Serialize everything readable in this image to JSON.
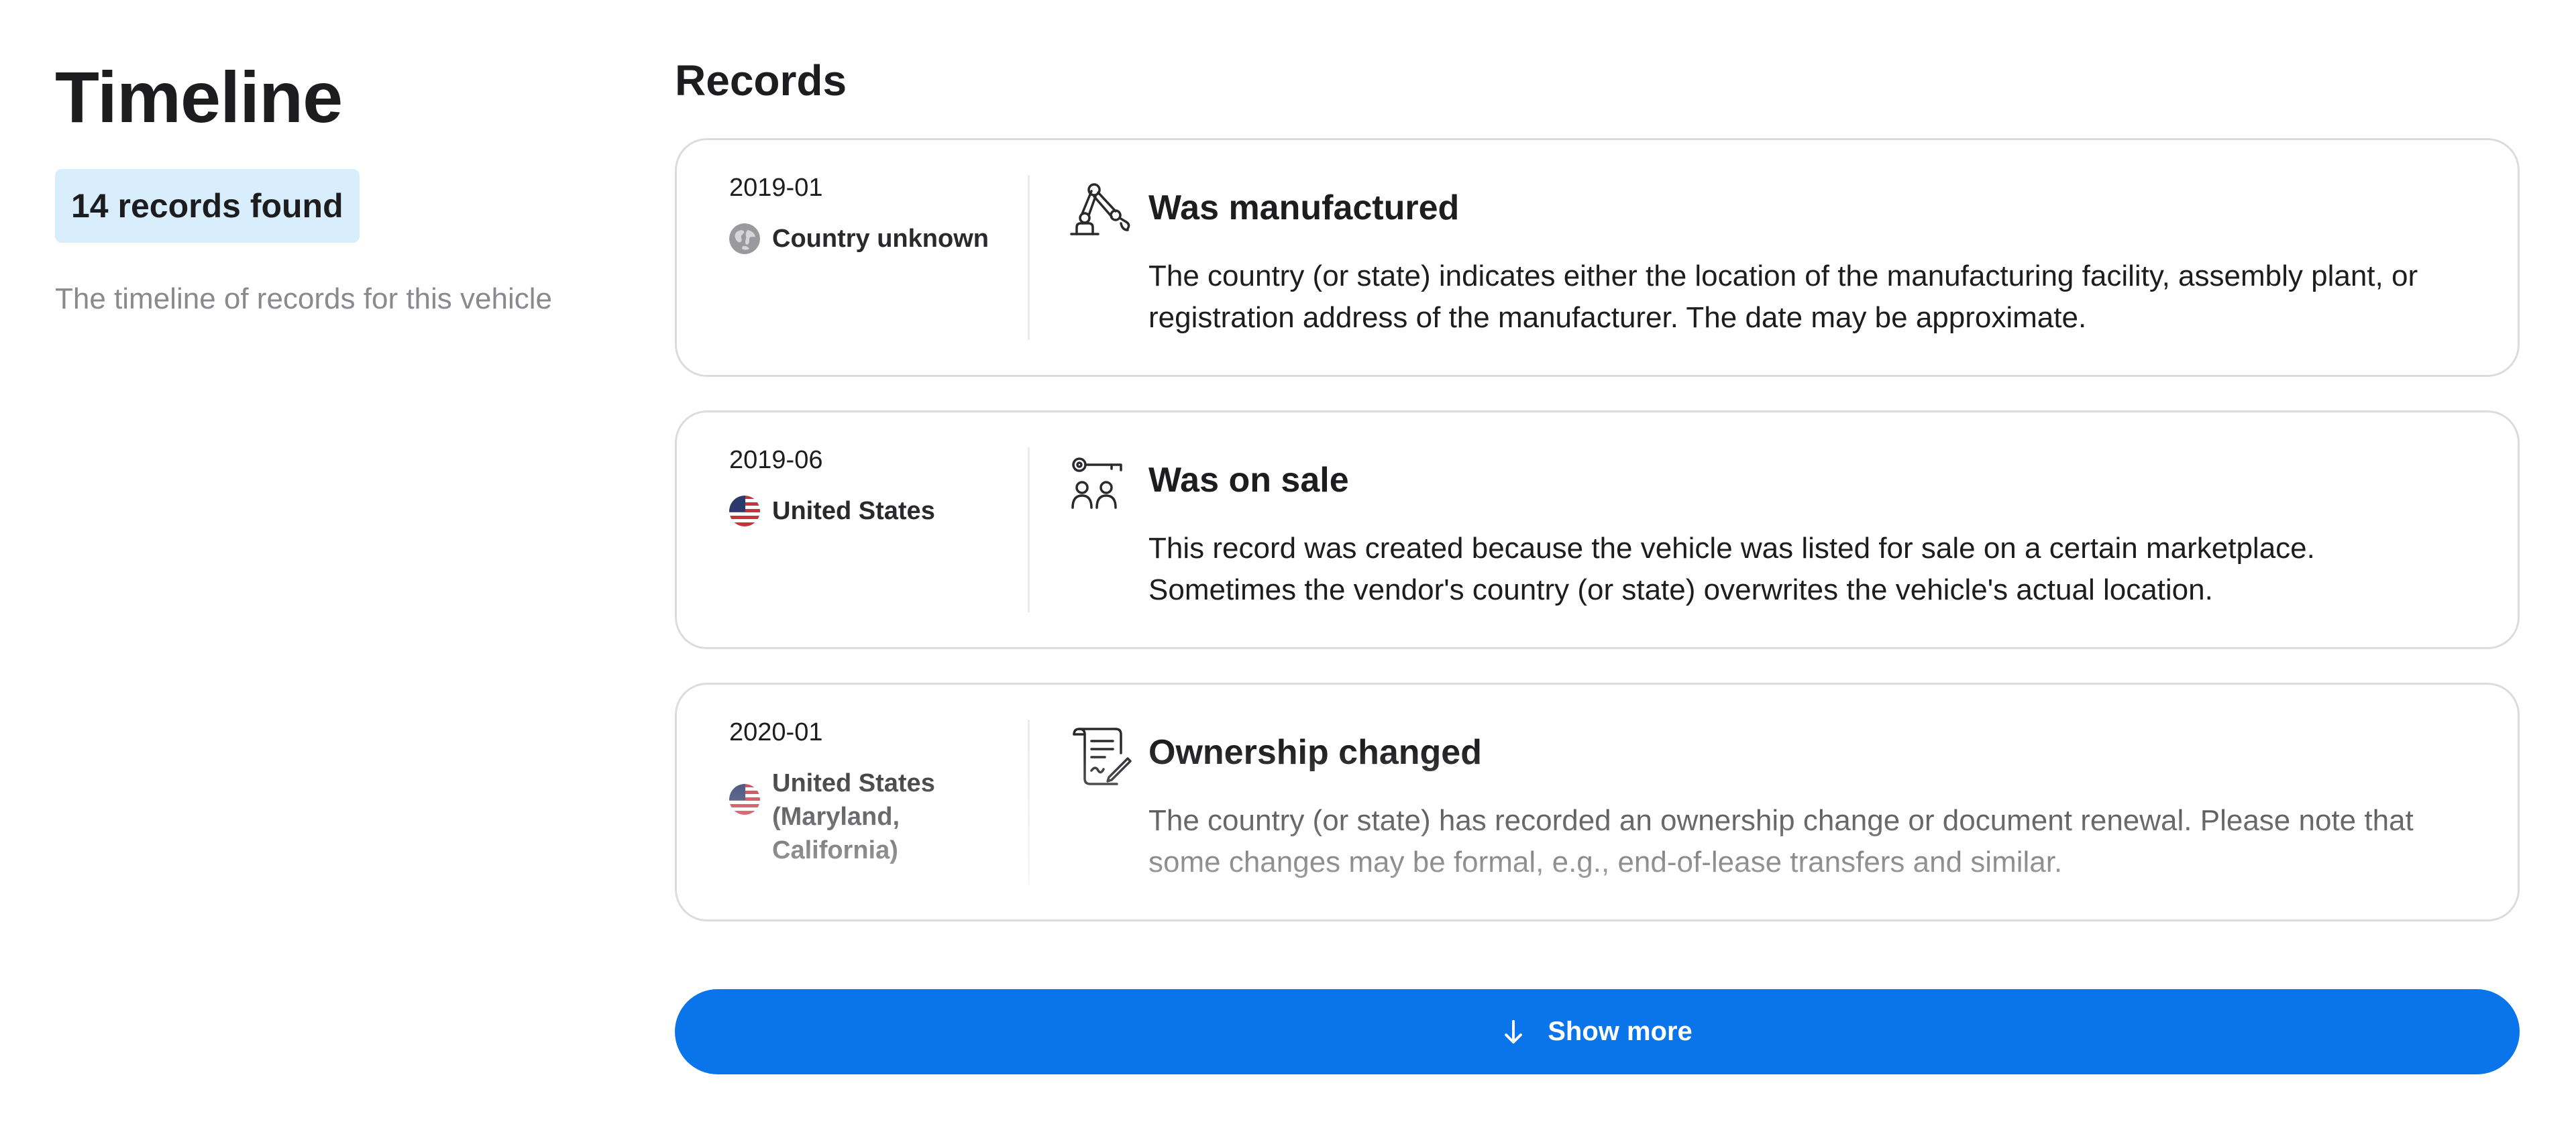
{
  "sidebar": {
    "title": "Timeline",
    "count_badge": "14 records found",
    "subtitle": "The timeline of records for this vehicle"
  },
  "main": {
    "heading": "Records",
    "records": [
      {
        "date": "2019-01",
        "country": "Country unknown",
        "flag_icon": "globe-icon",
        "icon": "robot-arm-icon",
        "title": "Was manufactured",
        "description": "The country (or state) indicates either the location of the manufacturing facility, assembly plant, or registration address of the manufacturer. The date may be approximate."
      },
      {
        "date": "2019-06",
        "country": "United States",
        "flag_icon": "us-flag-icon",
        "icon": "key-people-icon",
        "title": "Was on sale",
        "description": "This record was created because the vehicle was listed for sale on a certain marketplace. Sometimes the vendor's country (or state) overwrites the vehicle's actual location."
      },
      {
        "date": "2020-01",
        "country": "United States (Maryland, California)",
        "flag_icon": "us-flag-icon",
        "icon": "document-icon",
        "title": "Ownership changed",
        "description": "The country (or state) has recorded an ownership change or document renewal. Please note that some changes may be formal, e.g., end-of-lease transfers and similar."
      }
    ]
  },
  "show_more": {
    "label": "Show more",
    "icon": "arrow-down-icon"
  },
  "colors": {
    "accent": "#0a74ea",
    "badge_bg": "#d8eefc",
    "card_border": "#dcdcdf",
    "muted_text": "#8a8a8e"
  }
}
